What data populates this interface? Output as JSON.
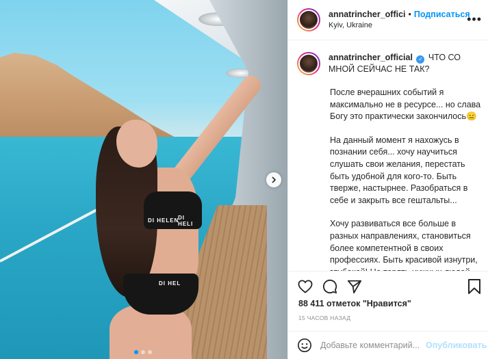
{
  "post": {
    "username": "annatrincher_offici",
    "separator": "•",
    "follow_label": "Подписаться",
    "location": "Kyiv, Ukraine",
    "more_label": "•••"
  },
  "caption": {
    "username": "annatrincher_official",
    "verified_mark": "✓",
    "headline": "ЧТО СО МНОЙ СЕЙЧАС НЕ ТАК?",
    "paragraphs": [
      "После вчерашних событий я максимально не в ресурсе... но слава Богу это практически закончилось😑",
      "На данный момент я нахожусь в познании себя... хочу научиться слушать свои желания, перестать быть удобной для кого-то. Быть тверже, настырнее. Разобраться в себе и закрыть все гештальты...",
      "Хочу развиваться все больше в разных направлениях, становиться более компетентной в своих профессиях. Быть красивой изнутри, глубокой! Не терять нужных людей"
    ]
  },
  "photo": {
    "brand_top": "DI HELEN",
    "brand_top_2": "DI HELI",
    "brand_bottom": "DI HEL"
  },
  "icons": {
    "like": "heart-icon",
    "comment": "comment-icon",
    "share": "share-icon",
    "save": "bookmark-icon",
    "next": "chevron-right-icon",
    "emoji": "smiley-icon"
  },
  "stats": {
    "likes": "88 411 отметок \"Нравится\"",
    "time": "15 ЧАСОВ НАЗАД"
  },
  "comment_box": {
    "placeholder": "Добавьте комментарий...",
    "publish_label": "Опубликовать"
  },
  "carousel": {
    "slides": 3,
    "active": 1
  },
  "colors": {
    "accent": "#0095f6",
    "publish_disabled": "#b2dffc",
    "text": "#262626",
    "muted": "#8e8e8e"
  }
}
